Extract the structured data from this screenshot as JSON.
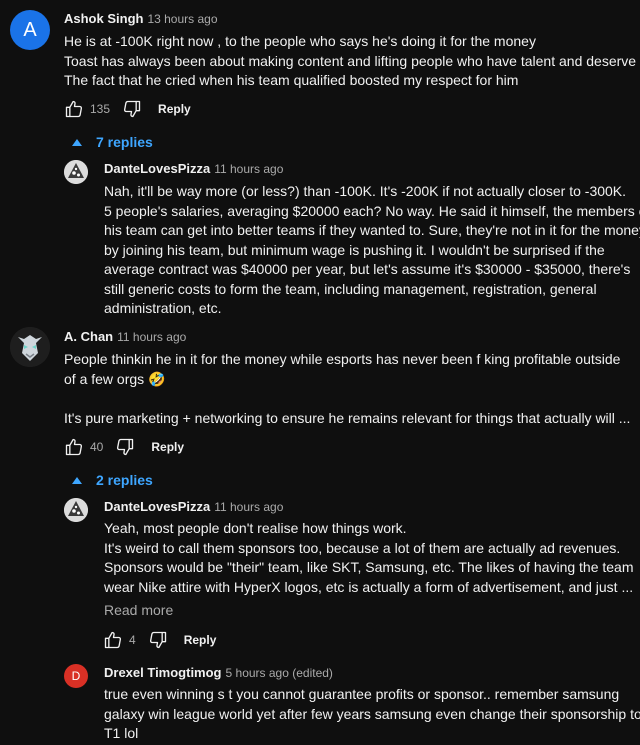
{
  "comments": [
    {
      "author": "Ashok Singh",
      "avatar_letter": "A",
      "avatar_color": "#1a73e8",
      "time": "13 hours ago",
      "lines": [
        "He is at -100K right now , to the people who says he's doing it for the money",
        "Toast has always been about making content and lifting people who have talent and deserve it",
        "The fact that he cried when his team qualified boosted my respect for him"
      ],
      "likes": "135",
      "reply_label": "Reply",
      "replies_toggle": "7 replies",
      "replies": [
        {
          "author": "DanteLovesPizza",
          "time": "11 hours ago",
          "lines": [
            "Nah, it'll be way more (or less?) than -100K. It's -200K if not actually closer to -300K.",
            "5 people's salaries, averaging $20000 each? No way. He said it himself, the members of",
            "his team can get into better teams if they wanted to. Sure, they're not in it for the money",
            "by joining his team, but minimum wage is pushing it. I wouldn't be surprised if the",
            "average contract was $40000 per year, but let's assume it's $30000 - $35000, there's",
            "still generic costs to form the team, including management, registration, general",
            "administration, etc."
          ]
        }
      ]
    },
    {
      "author": "A. Chan",
      "time": "11 hours ago",
      "lines": [
        "People thinkin he in it for the money while esports has never been f    king profitable outside",
        "of a few orgs 🤣",
        "",
        "It's pure marketing + networking to ensure he remains relevant for things that actually will ..."
      ],
      "likes": "40",
      "reply_label": "Reply",
      "replies_toggle": "2 replies",
      "replies": [
        {
          "author": "DanteLovesPizza",
          "time": "11 hours ago",
          "lines": [
            "Yeah, most people don't realise how things work.",
            "It's weird to call them sponsors too, because a lot of them are actually ad revenues.",
            "Sponsors would be \"their\" team, like SKT, Samsung, etc. The likes of having the team",
            "wear Nike attire with HyperX logos, etc is actually a form of advertisement, and just ..."
          ],
          "read_more": "Read more",
          "likes": "4",
          "reply_label": "Reply"
        },
        {
          "author": "Drexel Timogtimog",
          "avatar_letter": "D",
          "avatar_color": "#d93025",
          "time": "5 hours ago (edited)",
          "lines": [
            "true even winning s    t you cannot guarantee profits or sponsor.. remember samsung",
            "galaxy win league world yet after few years samsung even change their sponsorship to",
            "T1 lol"
          ]
        }
      ]
    }
  ]
}
